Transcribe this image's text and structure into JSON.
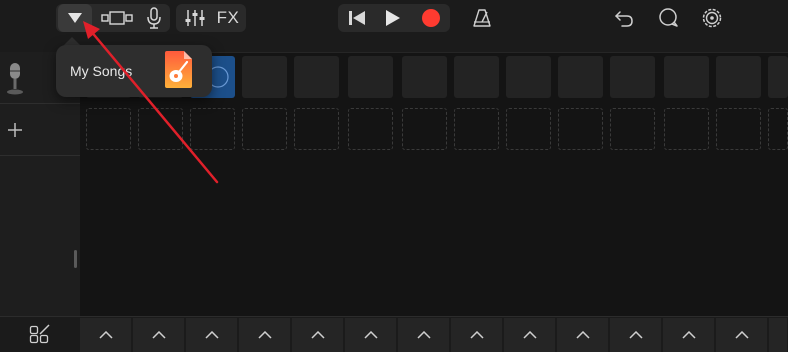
{
  "toolbar": {
    "left_group": [
      "my-songs-dropdown",
      "tracks-view",
      "microphone"
    ],
    "mix_group": [
      "mixer-controls",
      "fx"
    ],
    "fx_label": "FX",
    "transport": [
      "go-to-beginning",
      "play",
      "record"
    ],
    "right_buttons": [
      "metronome",
      "undo",
      "loop-browser",
      "settings"
    ]
  },
  "popup": {
    "label": "My Songs",
    "icon": "garageband-app-icon"
  },
  "tracks": [
    {
      "icon": "microphone-icon"
    },
    {
      "icon": "plus-icon"
    }
  ],
  "grid": {
    "columns": 14,
    "rows": 2
  },
  "colors": {
    "background": "#1b1b1b",
    "record_red": "#ff3b30",
    "active_cell_blue": "#1c4f8a",
    "annotation_red": "#e0202a"
  }
}
